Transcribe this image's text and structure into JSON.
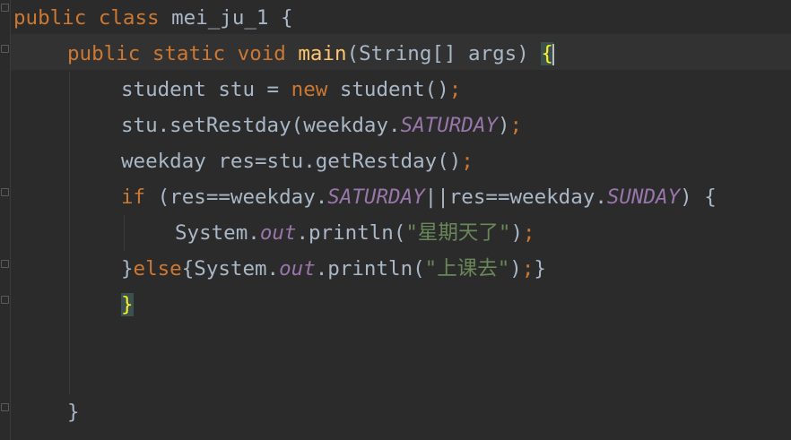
{
  "editor": {
    "lines": [
      {
        "indent": 0,
        "tokens": [
          {
            "t": "public class ",
            "c": "kw"
          },
          {
            "t": "mei_ju_1 {",
            "c": "plain"
          }
        ]
      },
      {
        "indent": 1,
        "tokens": [
          {
            "t": "public static void ",
            "c": "kw"
          },
          {
            "t": "main",
            "c": "fn"
          },
          {
            "t": "(String[] args) ",
            "c": "plain"
          },
          {
            "t": "{",
            "c": "brace-match"
          }
        ]
      },
      {
        "indent": 2,
        "tokens": [
          {
            "t": "student stu = ",
            "c": "plain"
          },
          {
            "t": "new ",
            "c": "kw"
          },
          {
            "t": "student()",
            "c": "plain"
          },
          {
            "t": ";",
            "c": "punc"
          }
        ]
      },
      {
        "indent": 2,
        "tokens": [
          {
            "t": "stu.setRestday(weekday.",
            "c": "plain"
          },
          {
            "t": "SATURDAY",
            "c": "const"
          },
          {
            "t": ")",
            "c": "plain"
          },
          {
            "t": ";",
            "c": "punc"
          }
        ]
      },
      {
        "indent": 2,
        "tokens": [
          {
            "t": "weekday res=stu.getRestday()",
            "c": "plain"
          },
          {
            "t": ";",
            "c": "punc"
          }
        ]
      },
      {
        "indent": 2,
        "tokens": [
          {
            "t": "if ",
            "c": "kw"
          },
          {
            "t": "(res==weekday.",
            "c": "plain"
          },
          {
            "t": "SATURDAY",
            "c": "const"
          },
          {
            "t": "||res==weekday.",
            "c": "plain"
          },
          {
            "t": "SUNDAY",
            "c": "const"
          },
          {
            "t": ") {",
            "c": "plain"
          }
        ]
      },
      {
        "indent": 3,
        "tokens": [
          {
            "t": "System.",
            "c": "plain"
          },
          {
            "t": "out",
            "c": "const"
          },
          {
            "t": ".println(",
            "c": "plain"
          },
          {
            "t": "\"星期天了\"",
            "c": "str"
          },
          {
            "t": ")",
            "c": "plain"
          },
          {
            "t": ";",
            "c": "punc"
          }
        ]
      },
      {
        "indent": 2,
        "tokens": [
          {
            "t": "}",
            "c": "plain"
          },
          {
            "t": "else",
            "c": "kw"
          },
          {
            "t": "{System.",
            "c": "plain"
          },
          {
            "t": "out",
            "c": "const"
          },
          {
            "t": ".println(",
            "c": "plain"
          },
          {
            "t": "\"上课去\"",
            "c": "str"
          },
          {
            "t": ")",
            "c": "plain"
          },
          {
            "t": ";",
            "c": "punc"
          },
          {
            "t": "}",
            "c": "plain"
          }
        ]
      },
      {
        "indent": 2,
        "tokens": [
          {
            "t": "}",
            "c": "brace-match"
          }
        ]
      },
      {
        "indent": 0,
        "tokens": []
      },
      {
        "indent": 0,
        "tokens": []
      },
      {
        "indent": 1,
        "tokens": [
          {
            "t": "}",
            "c": "plain"
          }
        ]
      }
    ]
  },
  "colors": {
    "background": "#2b2b2b",
    "keyword": "#cc7832",
    "method": "#ffc66d",
    "constant": "#9876aa",
    "string": "#6a8759",
    "text": "#a9b7c6",
    "brace_match_bg": "#3b514d",
    "brace_match_fg": "#ffef28"
  }
}
